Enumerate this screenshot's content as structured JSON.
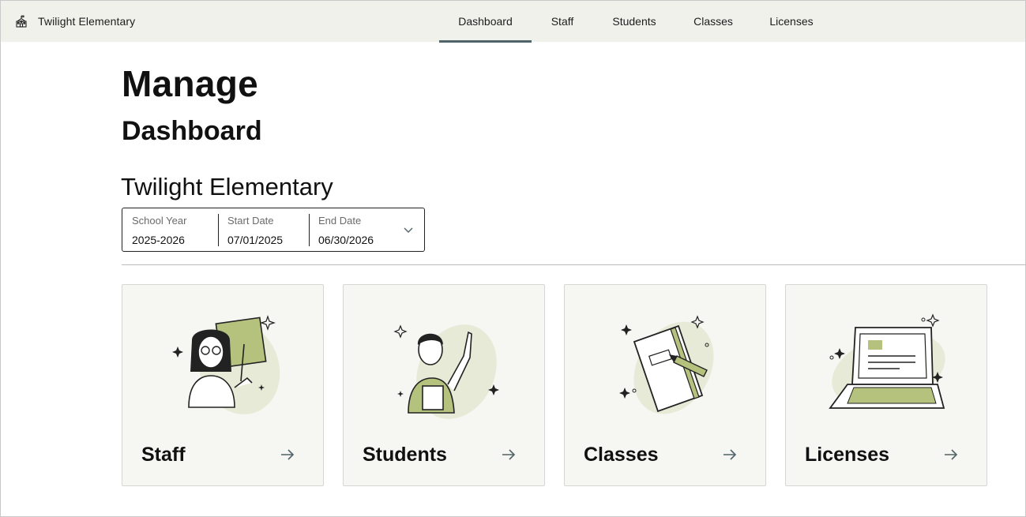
{
  "app": {
    "school_name": "Twilight Elementary",
    "brand_icon": "school-building-icon"
  },
  "nav": {
    "tabs": [
      {
        "label": "Dashboard",
        "active": true
      },
      {
        "label": "Staff",
        "active": false
      },
      {
        "label": "Students",
        "active": false
      },
      {
        "label": "Classes",
        "active": false
      },
      {
        "label": "Licenses",
        "active": false
      }
    ]
  },
  "page": {
    "title": "Manage",
    "subtitle": "Dashboard",
    "school_heading": "Twilight Elementary"
  },
  "year_selector": {
    "school_year_label": "School Year",
    "school_year_value": "2025-2026",
    "start_date_label": "Start Date",
    "start_date_value": "07/01/2025",
    "end_date_label": "End Date",
    "end_date_value": "06/30/2026",
    "icon": "chevron-down-icon"
  },
  "cards": [
    {
      "label": "Staff",
      "illustration": "teacher-illustration",
      "icon": "arrow-right-icon"
    },
    {
      "label": "Students",
      "illustration": "student-illustration",
      "icon": "arrow-right-icon"
    },
    {
      "label": "Classes",
      "illustration": "notebook-illustration",
      "icon": "arrow-right-icon"
    },
    {
      "label": "Licenses",
      "illustration": "laptop-illustration",
      "icon": "arrow-right-icon"
    }
  ],
  "colors": {
    "nav_bg": "#f1f1ec",
    "active_underline": "#4e6468",
    "card_bg": "#f6f6f3",
    "illustration_green": "#b5c27d",
    "illustration_blob": "#e6ead6",
    "arrow": "#4e6468"
  }
}
